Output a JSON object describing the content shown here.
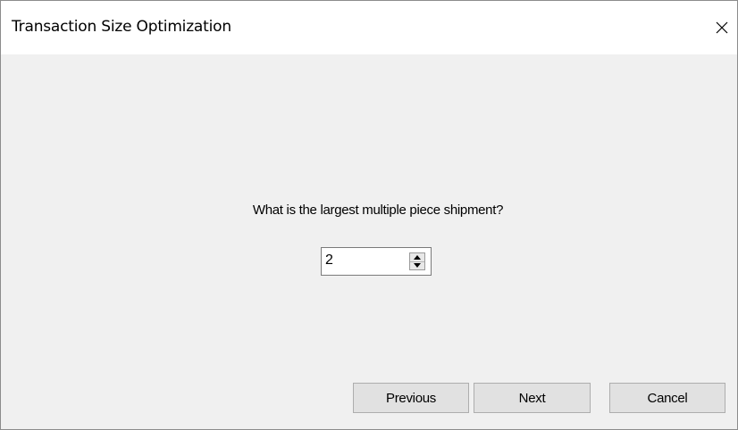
{
  "window": {
    "title": "Transaction Size Optimization",
    "close_icon": "close-icon"
  },
  "main": {
    "question": "What is the largest multiple piece shipment?",
    "quantity": {
      "value": "2",
      "up_icon": "arrow-up-icon",
      "down_icon": "arrow-down-icon"
    }
  },
  "buttons": {
    "previous_label": "Previous",
    "next_label": "Next",
    "cancel_label": "Cancel"
  }
}
